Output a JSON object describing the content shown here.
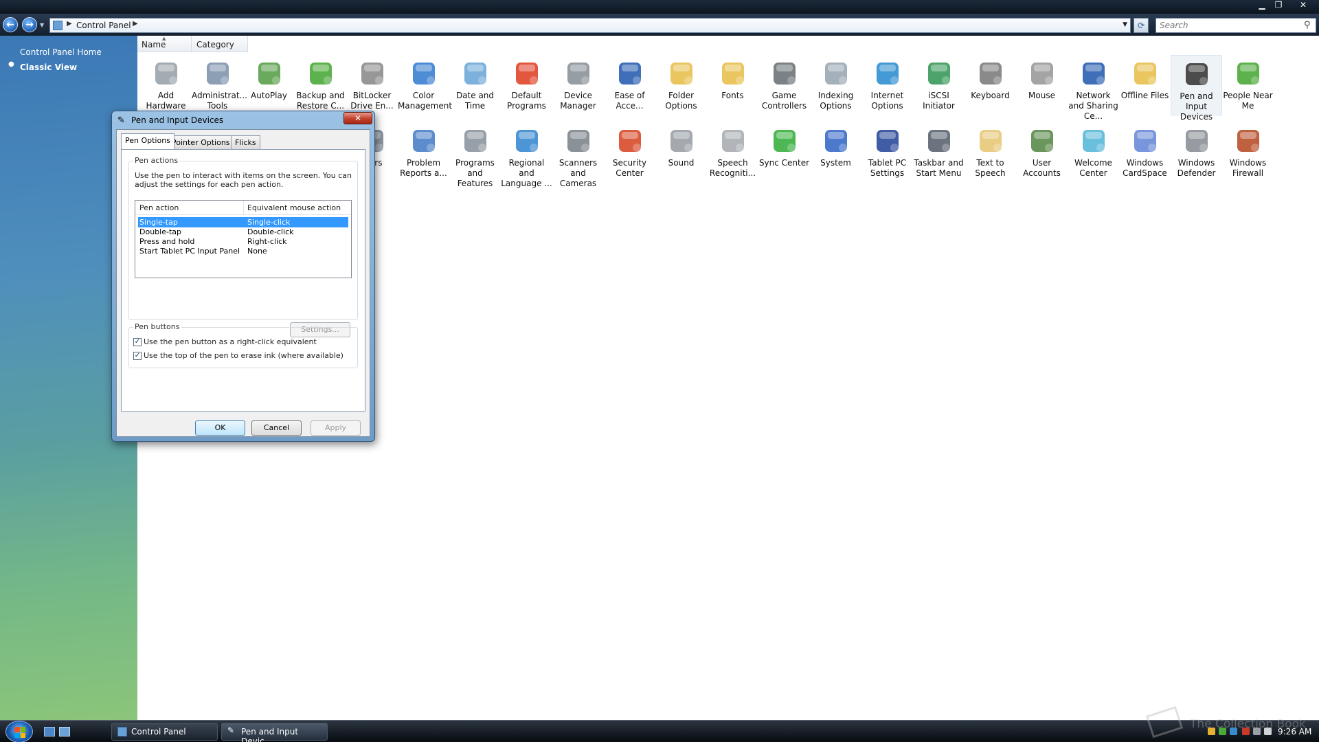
{
  "window": {
    "min_glyph": "▁",
    "max_glyph": "❐",
    "close_glyph": "✕"
  },
  "address": {
    "back_glyph": "←",
    "forward_glyph": "→",
    "dropdown_glyph": "▼",
    "separator_glyph": "▶",
    "location": "Control Panel",
    "refresh_glyph": "⟳",
    "search_placeholder": "Search",
    "search_glyph": "⚲"
  },
  "sidebar": {
    "home_label": "Control Panel Home",
    "bullet_glyph": "●",
    "classic_label": "Classic View"
  },
  "columns": {
    "name": "Name",
    "category": "Category",
    "sort_glyph": "▲"
  },
  "items": [
    {
      "id": "add-hardware",
      "label": "Add Hardware",
      "icon": "add-hardware-icon",
      "color": "#9aa3ab"
    },
    {
      "id": "admin-tools",
      "label": "Administrat... Tools",
      "icon": "administrative-tools-icon",
      "color": "#7f95ad"
    },
    {
      "id": "autoplay",
      "label": "AutoPlay",
      "icon": "autoplay-icon",
      "color": "#5aa14a"
    },
    {
      "id": "backup",
      "label": "Backup and Restore C...",
      "icon": "backup-icon",
      "color": "#4caa3a"
    },
    {
      "id": "bitlocker",
      "label": "BitLocker Drive En...",
      "icon": "bitlocker-icon",
      "color": "#8c8c8c"
    },
    {
      "id": "color-mgmt",
      "label": "Color Management",
      "icon": "color-management-icon",
      "color": "#3b7fd0"
    },
    {
      "id": "date-time",
      "label": "Date and Time",
      "icon": "date-time-icon",
      "color": "#6ea8d8"
    },
    {
      "id": "default-programs",
      "label": "Default Programs",
      "icon": "default-programs-icon",
      "color": "#e0452a"
    },
    {
      "id": "device-manager",
      "label": "Device Manager",
      "icon": "device-manager-icon",
      "color": "#8b9299"
    },
    {
      "id": "ease-access",
      "label": "Ease of Acce...",
      "icon": "ease-of-access-icon",
      "color": "#2a5fb0"
    },
    {
      "id": "folder-options",
      "label": "Folder Options",
      "icon": "folder-options-icon",
      "color": "#e8c050"
    },
    {
      "id": "fonts",
      "label": "Fonts",
      "icon": "fonts-icon",
      "color": "#e8c050"
    },
    {
      "id": "game-controllers",
      "label": "Game Controllers",
      "icon": "game-controllers-icon",
      "color": "#6d7378"
    },
    {
      "id": "indexing",
      "label": "Indexing Options",
      "icon": "indexing-options-icon",
      "color": "#9aa8b4"
    },
    {
      "id": "internet-options",
      "label": "Internet Options",
      "icon": "internet-options-icon",
      "color": "#2f8fd0"
    },
    {
      "id": "iscsi",
      "label": "iSCSI Initiator",
      "icon": "iscsi-initiator-icon",
      "color": "#3a9a5a"
    },
    {
      "id": "keyboard",
      "label": "Keyboard",
      "icon": "keyboard-icon",
      "color": "#7d7d7d"
    },
    {
      "id": "mouse",
      "label": "Mouse",
      "icon": "mouse-icon",
      "color": "#9a9a9a"
    },
    {
      "id": "network",
      "label": "Network and Sharing Ce...",
      "icon": "network-sharing-icon",
      "color": "#2a5fb0"
    },
    {
      "id": "offline-files",
      "label": "Offline Files",
      "icon": "offline-files-icon",
      "color": "#e8c050"
    },
    {
      "id": "pen-input",
      "label": "Pen and Input Devices",
      "icon": "pen-icon",
      "color": "#3a3a3a",
      "selected": true
    },
    {
      "id": "people-near-me",
      "label": "People Near Me",
      "icon": "people-near-me-icon",
      "color": "#4caa3a"
    },
    {
      "id": "performance",
      "label": "...ers",
      "icon": "performance-icon",
      "color": "#7f8a95"
    },
    {
      "id": "problem-reports",
      "label": "Problem Reports a...",
      "icon": "problem-reports-icon",
      "color": "#4a7fc8"
    },
    {
      "id": "programs-features",
      "label": "Programs and Features",
      "icon": "programs-features-icon",
      "color": "#8c96a0"
    },
    {
      "id": "regional",
      "label": "Regional and Language ...",
      "icon": "regional-language-icon",
      "color": "#3a8ad0"
    },
    {
      "id": "scanners",
      "label": "Scanners and Cameras",
      "icon": "scanners-cameras-icon",
      "color": "#7d858c"
    },
    {
      "id": "security-center",
      "label": "Security Center",
      "icon": "security-center-icon",
      "color": "#d84a2a"
    },
    {
      "id": "sound",
      "label": "Sound",
      "icon": "sound-icon",
      "color": "#9aa0a6"
    },
    {
      "id": "speech",
      "label": "Speech Recogniti...",
      "icon": "microphone-icon",
      "color": "#a8adb2"
    },
    {
      "id": "sync-center",
      "label": "Sync Center",
      "icon": "sync-center-icon",
      "color": "#3ab040"
    },
    {
      "id": "system",
      "label": "System",
      "icon": "system-icon",
      "color": "#3a6ac8"
    },
    {
      "id": "tablet-pc",
      "label": "Tablet PC Settings",
      "icon": "tablet-pc-icon",
      "color": "#2a4a9a"
    },
    {
      "id": "taskbar-start",
      "label": "Taskbar and Start Menu",
      "icon": "taskbar-start-icon",
      "color": "#5a6470"
    },
    {
      "id": "text-speech",
      "label": "Text to Speech",
      "icon": "text-to-speech-icon",
      "color": "#e8c878"
    },
    {
      "id": "user-accounts",
      "label": "User Accounts",
      "icon": "user-accounts-icon",
      "color": "#5a8a4a"
    },
    {
      "id": "welcome-center",
      "label": "Welcome Center",
      "icon": "welcome-center-icon",
      "color": "#5ab8d8"
    },
    {
      "id": "cardspace",
      "label": "Windows CardSpace",
      "icon": "cardspace-icon",
      "color": "#6a8ad8"
    },
    {
      "id": "defender",
      "label": "Windows Defender",
      "icon": "defender-icon",
      "color": "#8a9096"
    },
    {
      "id": "firewall",
      "label": "Windows Firewall",
      "icon": "firewall-icon",
      "color": "#b8502a"
    }
  ],
  "dialog": {
    "title": "Pen and Input Devices",
    "icon_glyph": "✎",
    "close_glyph": "✕",
    "tabs": [
      "Pen Options",
      "Pointer Options",
      "Flicks"
    ],
    "pen_actions": {
      "title": "Pen actions",
      "description": "Use the pen to interact with items on the screen.  You can adjust the settings for each pen action.",
      "headers": [
        "Pen action",
        "Equivalent mouse action"
      ],
      "rows": [
        {
          "action": "Single-tap",
          "mouse": "Single-click"
        },
        {
          "action": "Double-tap",
          "mouse": "Double-click"
        },
        {
          "action": "Press and hold",
          "mouse": "Right-click"
        },
        {
          "action": "Start Tablet PC Input Panel",
          "mouse": "None"
        }
      ],
      "settings_label": "Settings..."
    },
    "pen_buttons": {
      "title": "Pen buttons",
      "check_glyph": "✓",
      "option1": "Use the pen button as a right-click equivalent",
      "option2": "Use the top of the pen to erase ink (where available)"
    },
    "ok_label": "OK",
    "cancel_label": "Cancel",
    "apply_label": "Apply"
  },
  "taskbar": {
    "tasks": [
      "Control Panel",
      "Pen and Input Devic..."
    ],
    "clock": "9:26 AM",
    "watermark": "The Collection Book"
  }
}
